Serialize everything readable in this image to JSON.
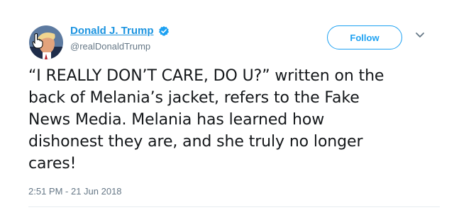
{
  "author": {
    "display_name": "Donald J. Trump",
    "handle": "@realDonaldTrump",
    "verified": true
  },
  "follow_label": "Follow",
  "tweet": {
    "text": "“I REALLY DON’T CARE, DO U?” written on the\nback of Melania’s jacket, refers to the Fake\nNews Media. Melania has learned how\ndishonest they are, and she truly no longer\ncares!",
    "timestamp": "2:51 PM - 21 Jun 2018"
  },
  "colors": {
    "link_blue": "#1c94e0",
    "button_blue": "#1da1f2",
    "secondary_gray": "#657786"
  },
  "icons": {
    "verified": "verified-badge-icon",
    "menu": "chevron-down-icon",
    "cursor": "hand-pointer-cursor"
  }
}
